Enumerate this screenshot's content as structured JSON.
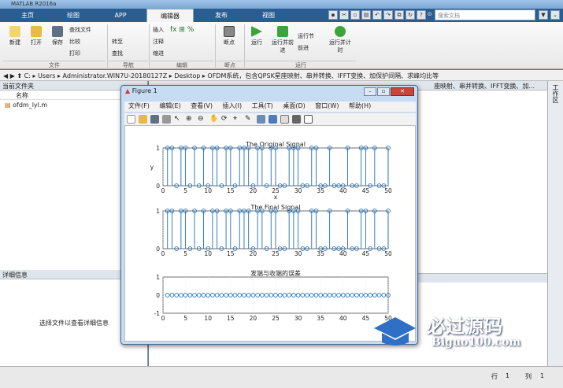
{
  "window": {
    "title": "MATLAB R2016a"
  },
  "tabs": [
    "主页",
    "绘图",
    "APP",
    "编辑器",
    "发布",
    "视图"
  ],
  "search": {
    "placeholder": "搜索文档"
  },
  "ribbon": {
    "buttons": [
      "新建",
      "打开",
      "保存",
      "查找文件",
      "比较",
      "打印",
      "转至",
      "查找",
      "插入",
      "注释",
      "缩进",
      "断点",
      "运行",
      "运行并前进",
      "运行节",
      "前进",
      "运行并计时"
    ],
    "groups": [
      "文件",
      "导航",
      "编辑",
      "断点",
      "运行"
    ]
  },
  "address": {
    "parts": [
      "C:",
      "Users",
      "Administrator.WIN7U-20180127Z",
      "Desktop",
      "OFDM系统，包含QPSK星座映射、串并转换、IFFT变换、加保护间隔、求峰均比等"
    ]
  },
  "left_panel": {
    "title": "当前文件夹",
    "col_header": "名称",
    "file": "ofdm_lyl.m",
    "details_title": "详细信息",
    "details_msg": "选择文件以查看详细信息"
  },
  "editor": {
    "tab_text": "座映射、串并转换、IFFT变换、加..."
  },
  "right_panel": {
    "label": "工作区"
  },
  "status": {
    "row_label": "行",
    "row": "1",
    "col_label": "列",
    "col": "1"
  },
  "figure": {
    "title": "Figure 1",
    "menu": [
      "文件(F)",
      "编辑(E)",
      "查看(V)",
      "插入(I)",
      "工具(T)",
      "桌面(D)",
      "窗口(W)",
      "帮助(H)"
    ]
  },
  "watermark": {
    "text": "必过源码",
    "url": "Biguo100.com"
  },
  "chart_data": [
    {
      "type": "scatter",
      "title": "The Original Signal",
      "xlabel": "x",
      "ylabel": "y",
      "xlim": [
        0,
        50
      ],
      "ylim": [
        0,
        1
      ],
      "xticks": [
        0,
        5,
        10,
        15,
        20,
        25,
        30,
        35,
        40,
        45,
        50
      ],
      "yticks": [
        0,
        1
      ],
      "x": [
        1,
        2,
        3,
        4,
        5,
        6,
        7,
        8,
        9,
        10,
        11,
        12,
        13,
        14,
        15,
        16,
        17,
        18,
        19,
        20,
        21,
        22,
        23,
        24,
        25,
        26,
        27,
        28,
        29,
        30,
        31,
        32,
        33,
        34,
        35,
        36,
        37,
        38,
        39,
        40,
        41,
        42,
        43,
        44,
        45,
        46,
        47,
        48,
        49,
        50
      ],
      "values": [
        1,
        1,
        0,
        1,
        1,
        0,
        1,
        0,
        1,
        0,
        1,
        1,
        0,
        1,
        1,
        0,
        1,
        1,
        1,
        0,
        1,
        1,
        0,
        1,
        1,
        0,
        0,
        1,
        1,
        1,
        0,
        0,
        1,
        1,
        0,
        0,
        1,
        0,
        0,
        0,
        1,
        0,
        0,
        1,
        1,
        0,
        1,
        0,
        0,
        1
      ]
    },
    {
      "type": "scatter",
      "title": "The Final Signal",
      "xlim": [
        0,
        50
      ],
      "ylim": [
        0,
        1
      ],
      "xticks": [
        0,
        5,
        10,
        15,
        20,
        25,
        30,
        35,
        40,
        45,
        50
      ],
      "yticks": [
        0,
        1
      ],
      "x": [
        1,
        2,
        3,
        4,
        5,
        6,
        7,
        8,
        9,
        10,
        11,
        12,
        13,
        14,
        15,
        16,
        17,
        18,
        19,
        20,
        21,
        22,
        23,
        24,
        25,
        26,
        27,
        28,
        29,
        30,
        31,
        32,
        33,
        34,
        35,
        36,
        37,
        38,
        39,
        40,
        41,
        42,
        43,
        44,
        45,
        46,
        47,
        48,
        49,
        50
      ],
      "values": [
        1,
        1,
        0,
        1,
        1,
        0,
        1,
        0,
        1,
        0,
        1,
        1,
        0,
        1,
        1,
        0,
        1,
        1,
        1,
        0,
        1,
        1,
        0,
        1,
        1,
        0,
        0,
        1,
        1,
        1,
        0,
        0,
        1,
        1,
        0,
        0,
        1,
        0,
        0,
        0,
        1,
        0,
        0,
        1,
        1,
        0,
        1,
        0,
        0,
        1
      ]
    },
    {
      "type": "scatter",
      "title": "发端与收端的误差",
      "xlim": [
        0,
        50
      ],
      "ylim": [
        -1,
        1
      ],
      "xticks": [
        0,
        5,
        10,
        15,
        20,
        25,
        30,
        35,
        40,
        45,
        50
      ],
      "yticks": [
        -1,
        0,
        1
      ],
      "x": [
        1,
        2,
        3,
        4,
        5,
        6,
        7,
        8,
        9,
        10,
        11,
        12,
        13,
        14,
        15,
        16,
        17,
        18,
        19,
        20,
        21,
        22,
        23,
        24,
        25,
        26,
        27,
        28,
        29,
        30,
        31,
        32,
        33,
        34,
        35,
        36,
        37,
        38,
        39,
        40,
        41,
        42,
        43,
        44,
        45,
        46,
        47,
        48,
        49,
        50
      ],
      "values": [
        0,
        0,
        0,
        0,
        0,
        0,
        0,
        0,
        0,
        0,
        0,
        0,
        0,
        0,
        0,
        0,
        0,
        0,
        0,
        0,
        0,
        0,
        0,
        0,
        0,
        0,
        0,
        0,
        0,
        0,
        0,
        0,
        0,
        0,
        0,
        0,
        0,
        0,
        0,
        0,
        0,
        0,
        0,
        0,
        0,
        0,
        0,
        0,
        0,
        0
      ]
    }
  ]
}
